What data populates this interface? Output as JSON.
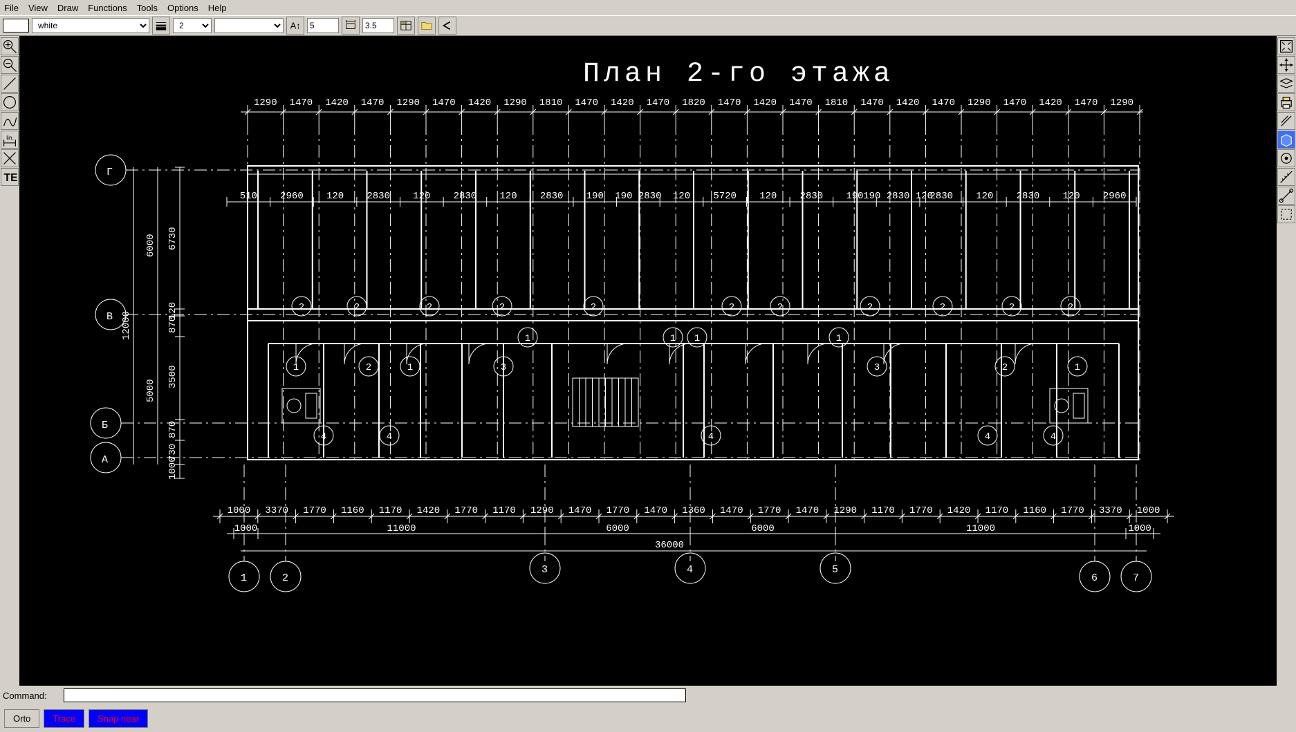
{
  "menu": {
    "items": [
      "File",
      "View",
      "Draw",
      "Functions",
      "Tools",
      "Options",
      "Help"
    ]
  },
  "toolbar": {
    "color_dropdown": "white",
    "lineweight_dropdown": "2",
    "linetype_dropdown": "",
    "textsize": "5",
    "dim_size": "3.5"
  },
  "left_tools": [
    "zoom-in",
    "zoom-out",
    "line",
    "circle",
    "curve",
    "dimension",
    "trim",
    "text"
  ],
  "right_tools": [
    "window-fit",
    "pan-arrows",
    "layers",
    "print",
    "copy",
    "3d",
    "properties",
    "measure",
    "align",
    "select-box"
  ],
  "drawing": {
    "title": "План 2-го этажа",
    "top_dims": [
      "1290",
      "1470",
      "1420",
      "1470",
      "1290",
      "1470",
      "1420",
      "1290",
      "1810",
      "1470",
      "1420",
      "1470",
      "1820",
      "1470",
      "1420",
      "1470",
      "1810",
      "1470",
      "1420",
      "1470",
      "1290",
      "1470",
      "1420",
      "1470",
      "1290"
    ],
    "upper_inner_dims": [
      "510",
      "2960",
      "120",
      "2830",
      "120",
      "2830",
      "120",
      "2830",
      "190",
      "190 2830",
      "120",
      "5720",
      "120",
      "2830",
      "190",
      "190 2830 120",
      "2830",
      "120",
      "2830",
      "120",
      "2960"
    ],
    "left_dims_outer": "12000",
    "left_dims_mid": [
      "6000",
      "5000"
    ],
    "left_dims_bub": [
      "6730",
      "120",
      "870",
      "3500",
      "870",
      "730",
      "1000"
    ],
    "row3_circles_top": [
      "2",
      "2",
      "2",
      "2",
      "2",
      "2",
      "2",
      "2",
      "2",
      "2",
      "2"
    ],
    "row_ones": [
      "1",
      "1",
      "1",
      "1"
    ],
    "mixed_row": [
      "1",
      "2",
      "1",
      "3",
      "3",
      "2",
      "1"
    ],
    "row_four": [
      "4",
      "4",
      "4",
      "4",
      "4"
    ],
    "bottom_dims": [
      "1000",
      "3370",
      "1770",
      "1160",
      "1170",
      "1420",
      "1770",
      "1170",
      "1290",
      "1470",
      "1770",
      "1470",
      "1360",
      "1470",
      "1770",
      "1470",
      "1290",
      "1170",
      "1770",
      "1420",
      "1170",
      "1160",
      "1770",
      "3370",
      "1000"
    ],
    "bottom_dims_mid": [
      "1000",
      "11000",
      "6000",
      "6000",
      "11000",
      "1000"
    ],
    "bottom_total": "36000",
    "col_bubbles": [
      "1",
      "2",
      "3",
      "4",
      "5",
      "6",
      "7"
    ],
    "row_bubbles_left": [
      "Г",
      "В",
      "Б",
      "А"
    ]
  },
  "command": {
    "label": "Command:",
    "value": ""
  },
  "status": {
    "orto": "Orto",
    "trace": "Trace",
    "snap": "Snap near"
  }
}
